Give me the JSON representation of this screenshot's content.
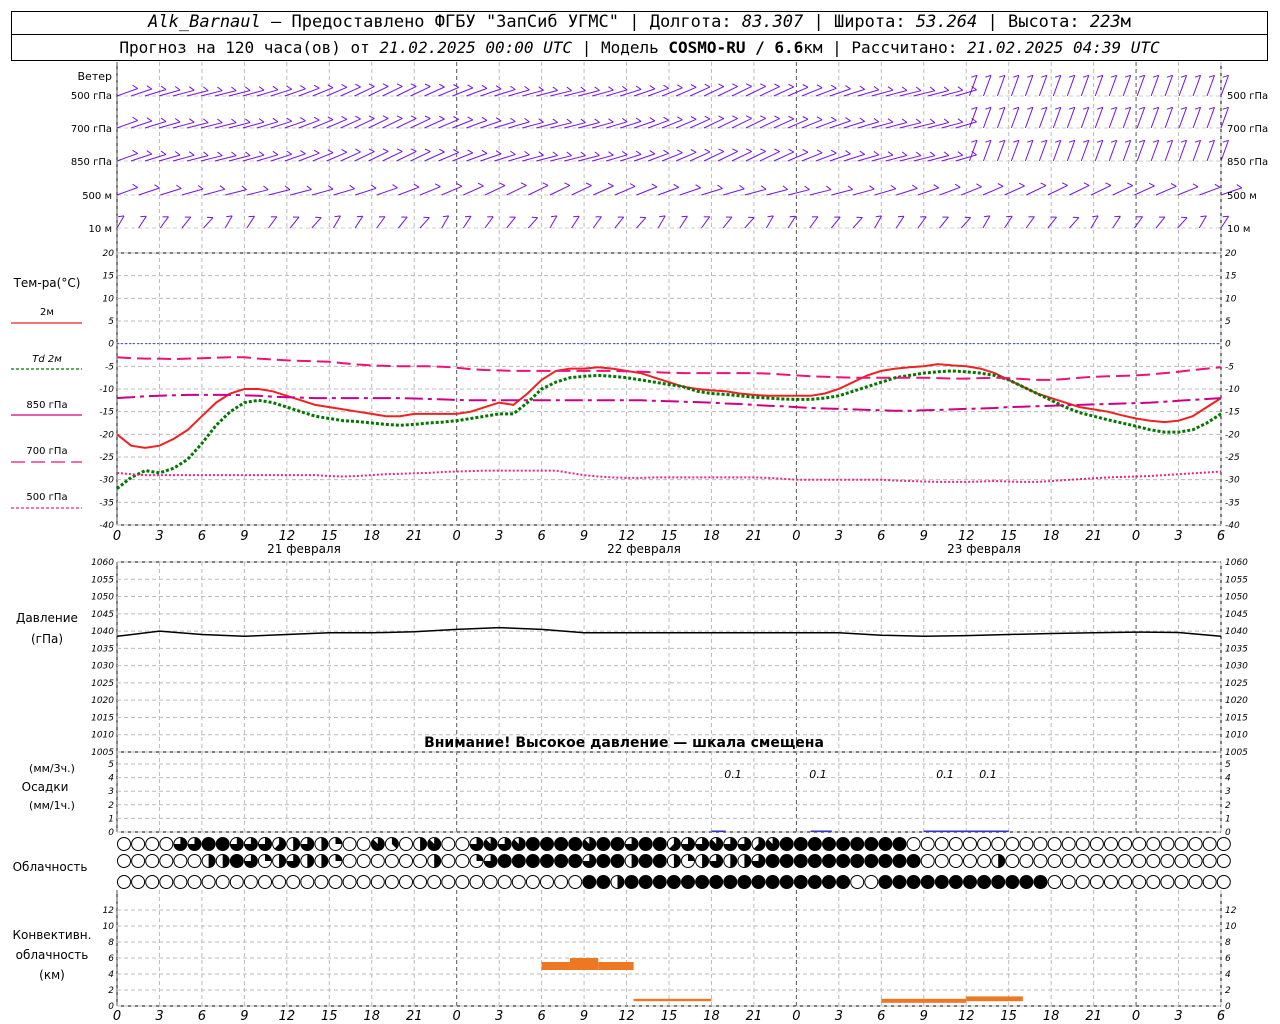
{
  "header": {
    "station": "Alk_Barnaul",
    "sep1": " — ",
    "provided": "Предоставлено ФГБУ \"ЗапСиб УГМС\"",
    "lon_label": " | Долгота: ",
    "lon": "83.307",
    "lat_label": " | Широта: ",
    "lat": "53.264",
    "alt_label": " | Высота: ",
    "alt": "223",
    "alt_unit": "м",
    "forecast_label": "Прогноз на 120 часа(ов) от ",
    "forecast_from": "21.02.2025 00:00 UTC",
    "model_label": "  | Модель ",
    "model": "COSMO-RU / 6.6",
    "model_unit": "км",
    "computed_label": " | Рассчитано: ",
    "computed": "21.02.2025 04:39 UTC"
  },
  "wind_panel": {
    "title": "Ветер",
    "levels": [
      "500 гПа",
      "700 гПа",
      "850 гПа",
      "500 м",
      "10  м"
    ]
  },
  "hour_ticks": [
    "0",
    "3",
    "6",
    "9",
    "12",
    "15",
    "18",
    "21",
    "0",
    "3",
    "6",
    "9",
    "12",
    "15",
    "18",
    "21",
    "0",
    "3",
    "6",
    "9",
    "12",
    "15",
    "18",
    "21",
    "0",
    "3",
    "6"
  ],
  "dates": [
    "21 февраля",
    "22 февраля",
    "23 февраля"
  ],
  "temp_panel": {
    "title": "Тем-ра(°С)",
    "legend": [
      {
        "label": "2м",
        "color": "#ee2222"
      },
      {
        "label": "Td  2м",
        "color": "#007700"
      },
      {
        "label": "850 гПа",
        "color": "#cc0088"
      },
      {
        "label": "700 гПа",
        "color": "#ee1177"
      },
      {
        "label": "500 гПа",
        "color": "#ee2288"
      }
    ]
  },
  "pressure_panel": {
    "title1": "Давление",
    "title2": "(гПа)",
    "warning": "Внимание! Высокое давление — шкала смещена"
  },
  "precip_panel": {
    "title1": "(мм/3ч.)",
    "title2": "Осадки",
    "title3": "(мм/1ч.)",
    "labels": [
      {
        "text": "0.1",
        "hour": 42
      },
      {
        "text": "0.1",
        "hour": 48
      },
      {
        "text": "0.1",
        "hour": 57
      },
      {
        "text": "0.1",
        "hour": 60
      }
    ]
  },
  "cloud_panel": {
    "title": "Облачность"
  },
  "conv_panel": {
    "title1": "Конвективн.",
    "title2": "облачность",
    "title3": "(км)"
  },
  "chart_data": [
    {
      "type": "line",
      "name": "temperature",
      "xlim": [
        0,
        78
      ],
      "ylim": [
        -40,
        20
      ],
      "y_ticks": [
        -40,
        -35,
        -30,
        -25,
        -20,
        -15,
        -10,
        -5,
        0,
        5,
        10,
        15,
        20
      ],
      "x": [
        0,
        1,
        2,
        3,
        4,
        5,
        6,
        7,
        8,
        9,
        10,
        11,
        12,
        13,
        14,
        15,
        16,
        17,
        18,
        19,
        20,
        21,
        22,
        23,
        24,
        25,
        26,
        27,
        28,
        29,
        30,
        31,
        32,
        33,
        34,
        35,
        36,
        37,
        38,
        39,
        40,
        41,
        42,
        43,
        44,
        45,
        46,
        47,
        48,
        49,
        50,
        51,
        52,
        53,
        54,
        55,
        56,
        57,
        58,
        59,
        60,
        61,
        62,
        63,
        64,
        65,
        66,
        67,
        68,
        69,
        70,
        71,
        72,
        73,
        74,
        75,
        76,
        77,
        78
      ],
      "series": [
        {
          "name": "2м",
          "color": "#ee2222",
          "dash": "",
          "values": [
            -20,
            -22.5,
            -23,
            -22.5,
            -21,
            -19,
            -16,
            -13,
            -11,
            -10,
            -10,
            -10.5,
            -11.5,
            -12.5,
            -13.5,
            -14,
            -14.5,
            -15,
            -15.5,
            -16,
            -16,
            -15.5,
            -15.5,
            -15.5,
            -15.5,
            -15,
            -14,
            -13,
            -13.5,
            -11,
            -8,
            -6,
            -5.5,
            -5.5,
            -5.2,
            -5.5,
            -6,
            -6.5,
            -7.5,
            -8.5,
            -9.5,
            -10,
            -10.3,
            -10.5,
            -11,
            -11.3,
            -11.5,
            -11.5,
            -11.5,
            -11.5,
            -11,
            -10,
            -8.5,
            -7,
            -6,
            -5.5,
            -5.2,
            -5,
            -4.5,
            -4.8,
            -5,
            -5.5,
            -6.5,
            -8,
            -9.5,
            -11,
            -12,
            -13,
            -14,
            -14.5,
            -15,
            -15.8,
            -16.5,
            -17,
            -17.3,
            -17,
            -16,
            -14,
            -12
          ]
        },
        {
          "name": "Td  2м",
          "color": "#007700",
          "dash": "3,2",
          "values": [
            -32,
            -29.5,
            -28,
            -28.5,
            -27.5,
            -25.5,
            -22,
            -18,
            -15,
            -13,
            -12.5,
            -13,
            -14,
            -15,
            -16,
            -16.5,
            -17,
            -17.2,
            -17.5,
            -17.8,
            -18,
            -17.8,
            -17.5,
            -17.3,
            -17,
            -16.5,
            -16,
            -15.5,
            -15.5,
            -13,
            -10,
            -8.5,
            -7.5,
            -7.2,
            -7,
            -7.2,
            -7.5,
            -8,
            -8.5,
            -9,
            -9.5,
            -10.5,
            -11,
            -11.2,
            -11.5,
            -11.8,
            -12,
            -12.2,
            -12.3,
            -12.3,
            -12,
            -11.5,
            -10.5,
            -9.5,
            -8.5,
            -7.5,
            -7,
            -6.5,
            -6.2,
            -6,
            -6.2,
            -6.5,
            -7,
            -8,
            -9.5,
            -11,
            -12.5,
            -14,
            -15.2,
            -16,
            -16.8,
            -17.5,
            -18.2,
            -19,
            -19.5,
            -19.5,
            -19,
            -17.5,
            -15.5
          ]
        },
        {
          "name": "850 гПа",
          "color": "#cc0088",
          "dash": "18,5,4,5",
          "values": [
            -12,
            -11.8,
            -11.6,
            -11.5,
            -11.4,
            -11.3,
            -11.3,
            -11.3,
            -11.3,
            -11.4,
            -11.5,
            -11.7,
            -11.8,
            -11.9,
            -12,
            -12,
            -12,
            -12,
            -12,
            -12,
            -12,
            -12.1,
            -12.2,
            -12.3,
            -12.4,
            -12.5,
            -12.5,
            -12.5,
            -12.5,
            -12.5,
            -12.5,
            -12.5,
            -12.5,
            -12.5,
            -12.5,
            -12.5,
            -12.5,
            -12.5,
            -12.6,
            -12.7,
            -12.8,
            -12.9,
            -13,
            -13.2,
            -13.3,
            -13.5,
            -13.7,
            -13.8,
            -14,
            -14.2,
            -14.3,
            -14.4,
            -14.5,
            -14.6,
            -14.7,
            -14.8,
            -14.8,
            -14.7,
            -14.6,
            -14.5,
            -14.4,
            -14.3,
            -14.2,
            -14,
            -13.9,
            -13.8,
            -13.7,
            -13.6,
            -13.5,
            -13.4,
            -13.3,
            -13.2,
            -13.1,
            -13,
            -12.8,
            -12.6,
            -12.4,
            -12.2,
            -12
          ]
        },
        {
          "name": "700 гПа",
          "color": "#ee1177",
          "dash": "14,6",
          "values": [
            -3,
            -3.2,
            -3.3,
            -3.3,
            -3.4,
            -3.3,
            -3.2,
            -3.1,
            -3,
            -3,
            -3.3,
            -3.5,
            -3.7,
            -3.8,
            -3.9,
            -4,
            -4.3,
            -4.6,
            -4.8,
            -4.9,
            -5,
            -5,
            -5,
            -5.1,
            -5.3,
            -5.6,
            -5.8,
            -5.9,
            -6,
            -6,
            -6,
            -6,
            -6,
            -6,
            -6,
            -6,
            -6.1,
            -6.2,
            -6.3,
            -6.4,
            -6.5,
            -6.5,
            -6.5,
            -6.5,
            -6.5,
            -6.5,
            -6.6,
            -6.8,
            -7,
            -7.2,
            -7.3,
            -7.4,
            -7.5,
            -7.5,
            -7.5,
            -7.5,
            -7.5,
            -7.5,
            -7.6,
            -7.7,
            -7.7,
            -7.6,
            -7.5,
            -7.6,
            -7.8,
            -8,
            -8,
            -7.8,
            -7.5,
            -7.3,
            -7.2,
            -7.1,
            -7,
            -6.8,
            -6.5,
            -6.2,
            -5.8,
            -5.5,
            -5.2
          ]
        },
        {
          "name": "500 гПа",
          "color": "#ee2288",
          "dash": "2,2",
          "values": [
            -28.5,
            -28.8,
            -29,
            -29,
            -29,
            -29,
            -29,
            -29,
            -29,
            -29,
            -29,
            -29,
            -29,
            -29,
            -29,
            -29.2,
            -29.3,
            -29.2,
            -29,
            -28.8,
            -28.7,
            -28.6,
            -28.5,
            -28.3,
            -28.2,
            -28.1,
            -28,
            -28,
            -28,
            -28,
            -28,
            -28,
            -28.5,
            -29,
            -29.3,
            -29.5,
            -29.6,
            -29.6,
            -29.5,
            -29.5,
            -29.5,
            -29.5,
            -29.5,
            -29.5,
            -29.5,
            -29.5,
            -29.6,
            -29.8,
            -30,
            -30,
            -30,
            -30,
            -30,
            -30,
            -30,
            -30.2,
            -30.3,
            -30.4,
            -30.5,
            -30.5,
            -30.5,
            -30.4,
            -30.3,
            -30.4,
            -30.5,
            -30.5,
            -30.3,
            -30.1,
            -29.9,
            -29.7,
            -29.5,
            -29.4,
            -29.3,
            -29.2,
            -29,
            -28.8,
            -28.6,
            -28.4,
            -28.2
          ]
        }
      ]
    },
    {
      "type": "line",
      "name": "pressure",
      "xlim": [
        0,
        78
      ],
      "ylim": [
        1005,
        1060
      ],
      "y_ticks": [
        1005,
        1010,
        1015,
        1020,
        1025,
        1030,
        1035,
        1040,
        1045,
        1050,
        1055,
        1060
      ],
      "x": [
        0,
        3,
        6,
        9,
        12,
        15,
        18,
        21,
        24,
        27,
        30,
        33,
        36,
        39,
        42,
        45,
        48,
        51,
        54,
        57,
        60,
        63,
        66,
        69,
        72,
        75,
        78
      ],
      "series": [
        {
          "name": "pressure",
          "color": "#000000",
          "values": [
            1038.5,
            1040,
            1039,
            1038.5,
            1039,
            1039.5,
            1039.5,
            1039.8,
            1040.5,
            1041,
            1040.5,
            1039.5,
            1039.5,
            1039.5,
            1039.5,
            1039.5,
            1039.5,
            1039.5,
            1038.8,
            1038.5,
            1038.7,
            1039,
            1039.3,
            1039.5,
            1039.7,
            1039.6,
            1038.5
          ]
        }
      ]
    },
    {
      "type": "bar",
      "name": "precipitation",
      "xlim": [
        0,
        78
      ],
      "ylim": [
        0,
        5
      ],
      "y_ticks": [
        0,
        1,
        2,
        3,
        4,
        5
      ],
      "series": [
        {
          "name": "мм/3ч",
          "color": "#3333cc",
          "values": [
            {
              "x0": 42,
              "x1": 43,
              "v": 0.1
            },
            {
              "x0": 49,
              "x1": 50.5,
              "v": 0.1
            },
            {
              "x0": 57,
              "x1": 60,
              "v": 0.1
            },
            {
              "x0": 60,
              "x1": 63,
              "v": 0.1
            }
          ]
        }
      ]
    },
    {
      "type": "table",
      "name": "cloud_cover",
      "legend_note": "octas per hour, rows: upper/middle/lower",
      "rows": [
        [
          0,
          0,
          0,
          0,
          6,
          6,
          8,
          8,
          6,
          6,
          6,
          5,
          4,
          6,
          4,
          2,
          0,
          0,
          7,
          3,
          0,
          4,
          7,
          0,
          0,
          6,
          7,
          6,
          7,
          8,
          8,
          8,
          8,
          7,
          8,
          8,
          6,
          8,
          8,
          5,
          6,
          6,
          7,
          6,
          6,
          5,
          7,
          8,
          8,
          8,
          8,
          8,
          8,
          8,
          8,
          8,
          0,
          0,
          0,
          0,
          0,
          0,
          0,
          0,
          0,
          0,
          0,
          0,
          0,
          0,
          0,
          0,
          0,
          0,
          0,
          0,
          0,
          0,
          0
        ],
        [
          0,
          0,
          0,
          0,
          0,
          0,
          4,
          4,
          8,
          6,
          2,
          4,
          6,
          4,
          4,
          2,
          0,
          0,
          0,
          0,
          0,
          0,
          4,
          0,
          0,
          2,
          6,
          8,
          8,
          8,
          8,
          8,
          8,
          6,
          8,
          8,
          4,
          8,
          8,
          4,
          2,
          4,
          6,
          4,
          4,
          6,
          8,
          8,
          8,
          8,
          8,
          8,
          8,
          8,
          8,
          8,
          8,
          0,
          0,
          0,
          0,
          0,
          4,
          0,
          0,
          0,
          0,
          0,
          0,
          0,
          0,
          0,
          0,
          0,
          0,
          0,
          0,
          0,
          0
        ],
        [
          0,
          0,
          0,
          0,
          0,
          0,
          0,
          0,
          0,
          0,
          0,
          0,
          0,
          0,
          0,
          0,
          0,
          0,
          0,
          0,
          0,
          0,
          0,
          0,
          0,
          0,
          0,
          0,
          0,
          0,
          0,
          0,
          0,
          8,
          8,
          4,
          8,
          8,
          8,
          8,
          8,
          8,
          8,
          8,
          8,
          8,
          8,
          8,
          8,
          8,
          8,
          8,
          0,
          0,
          8,
          8,
          8,
          8,
          8,
          8,
          8,
          8,
          8,
          8,
          8,
          8,
          0,
          0,
          0,
          0,
          0,
          0,
          0,
          0,
          0,
          0,
          0,
          0,
          0
        ]
      ]
    },
    {
      "type": "bar",
      "name": "convective_cloud",
      "xlim": [
        0,
        78
      ],
      "ylim": [
        0,
        14
      ],
      "y_ticks": [
        0,
        2,
        4,
        6,
        8,
        10,
        12
      ],
      "series": [
        {
          "name": "convective",
          "color": "#ee7722",
          "values": [
            {
              "x0": 30,
              "x1": 32,
              "base": 4.5,
              "top": 5.5
            },
            {
              "x0": 32,
              "x1": 34,
              "base": 4.5,
              "top": 6
            },
            {
              "x0": 34,
              "x1": 36,
              "base": 4.5,
              "top": 5.5
            },
            {
              "x0": 36,
              "x1": 36.5,
              "base": 4.5,
              "top": 5.5
            },
            {
              "x0": 36.5,
              "x1": 42,
              "base": 0.6,
              "top": 0.9
            },
            {
              "x0": 54,
              "x1": 60,
              "base": 0.4,
              "top": 0.9
            },
            {
              "x0": 60,
              "x1": 64,
              "base": 0.6,
              "top": 1.2
            }
          ]
        }
      ]
    }
  ]
}
